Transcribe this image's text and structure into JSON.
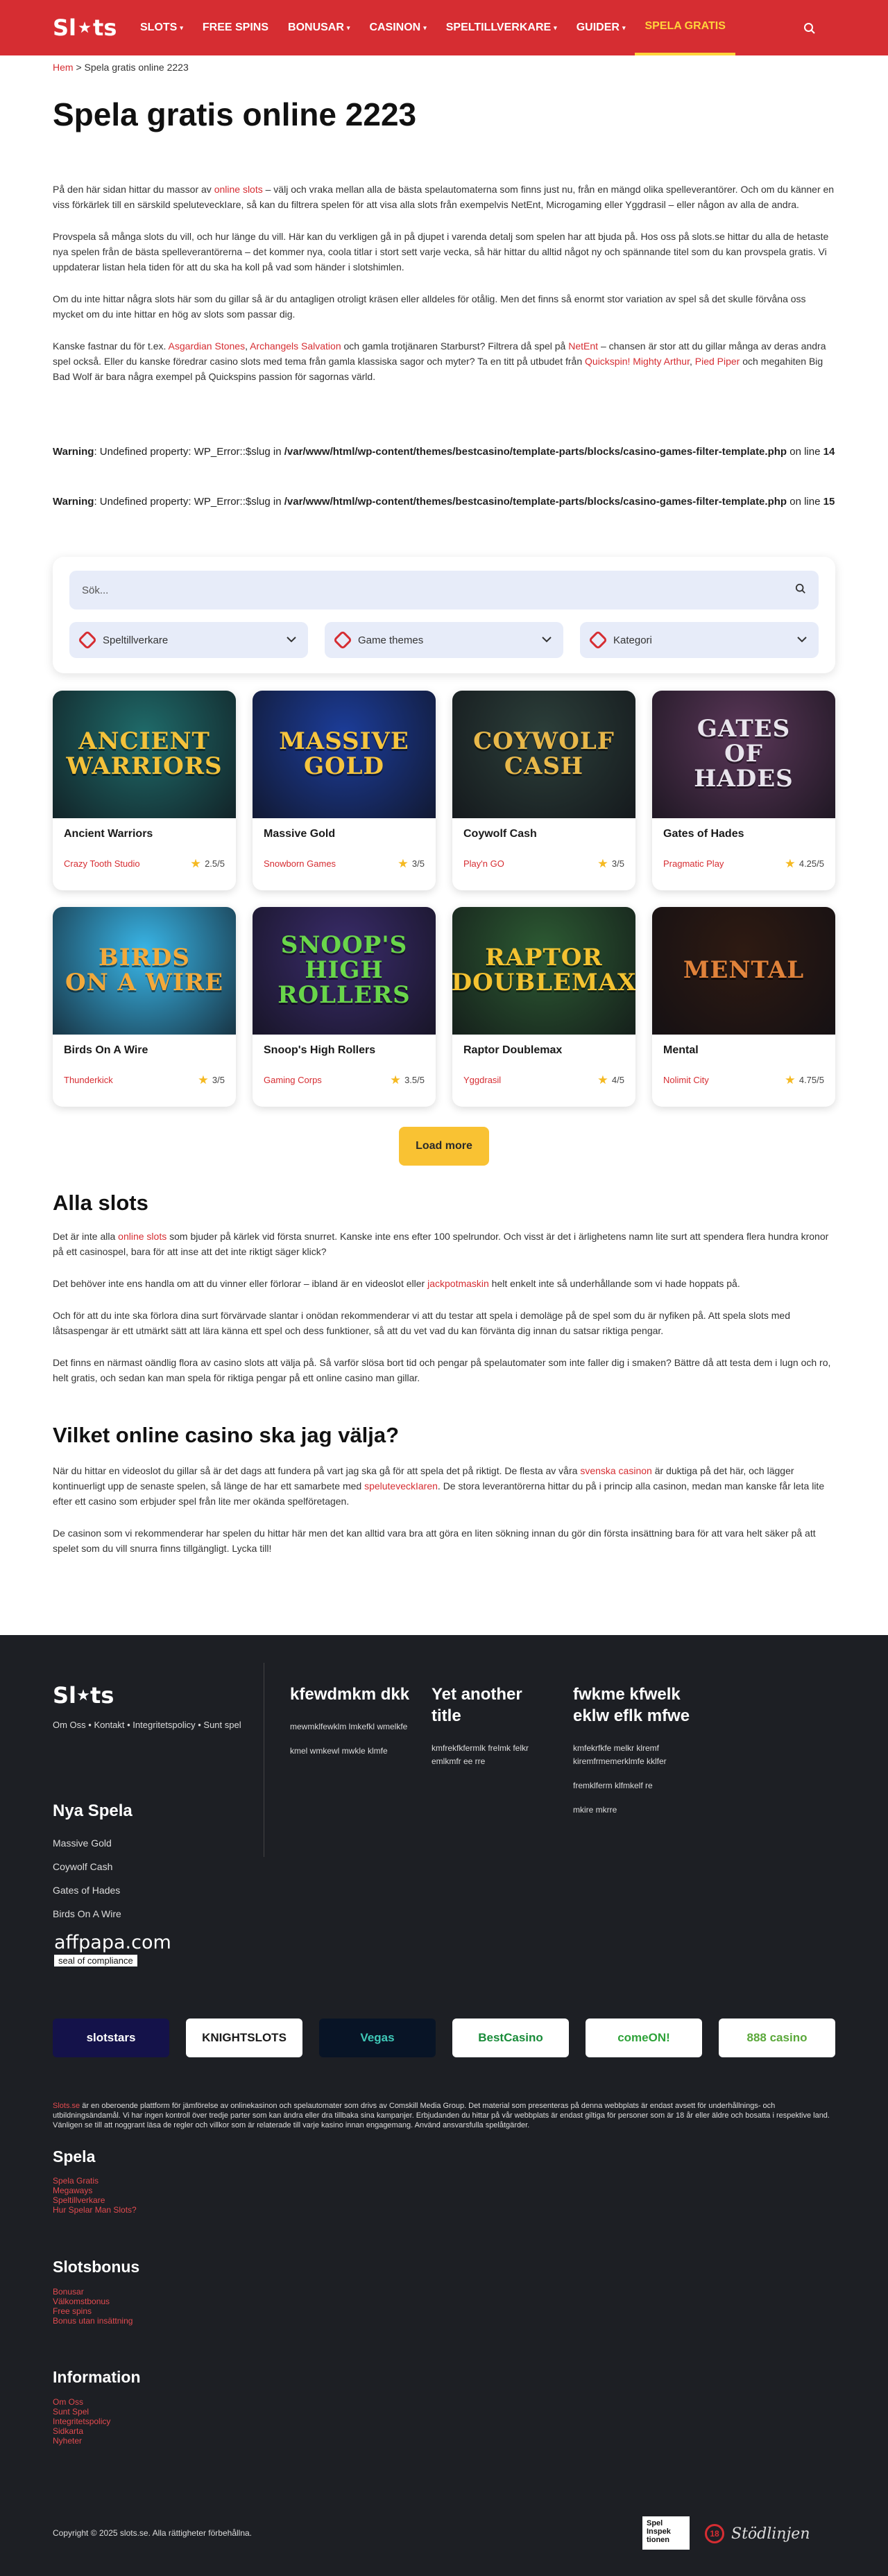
{
  "brand": {
    "logo_left": "Sl",
    "logo_right": "ts"
  },
  "nav": {
    "items": [
      {
        "label": "SLOTS",
        "caret": "▾"
      },
      {
        "label": "FREE SPINS",
        "caret": ""
      },
      {
        "label": "BONUSAR",
        "caret": "▾"
      },
      {
        "label": "CASINON",
        "caret": "▾"
      },
      {
        "label": "SPELTILLVERKARE",
        "caret": "▾"
      },
      {
        "label": "GUIDER",
        "caret": "▾"
      },
      {
        "label": "SPELA GRATIS",
        "caret": ""
      }
    ],
    "search_icon": "search-icon"
  },
  "breadcrumb": {
    "home": "Hem",
    "separator": ">",
    "current": "Spela gratis online 2223"
  },
  "page_title": "Spela gratis online 2223",
  "intro": {
    "p1_a": "På den här sidan hittar du massor av ",
    "p1_link": "online slots",
    "p1_b": " – välj och vraka mellan alla de bästa spelautomaterna som finns just nu, från en mängd olika spelleverantörer. Och om du känner en viss förkärlek till en särskild speluteveckIare, så kan du filtrera spelen för att visa alla slots från exempelvis NetEnt, Microgaming eller Yggdrasil – eller någon av alla de andra.",
    "p2": "Provspela så många slots du vill, och hur länge du vill. Här kan du verkligen gå in på djupet i varenda detalj som spelen har att bjuda på. Hos oss på slots.se hittar du alla de hetaste nya spelen från de bästa spelleverantörerna – det kommer nya, coola titlar i stort sett varje vecka, så här hittar du alltid något ny och spännande titel som du kan provspela gratis. Vi uppdaterar listan hela tiden för att du ska ha koll på vad som händer i slotshimlen.",
    "p3": "Om du inte hittar några slots här som du gillar så är du antagligen otroligt kräsen eller alldeles för otålig. Men det finns så enormt stor variation av spel så det skulle förvåna oss mycket om du inte hittar en hög av slots som passar dig.",
    "p4_a": "Kanske fastnar du för t.ex. ",
    "p4_l1": "Asgardian Stones",
    "p4_c1": ", ",
    "p4_l2": "Archangels Salvation",
    "p4_b": " och gamla trotjänaren Starburst? Filtrera då spel på ",
    "p4_l3": "NetEnt",
    "p4_c": " – chansen är stor att du gillar många av deras andra spel också. Eller du kanske föredrar casino slots med tema från gamla klassiska sagor och myter? Ta en titt på utbudet från ",
    "p4_l4": "Quickspin!",
    "p4_d": " ",
    "p4_l5": "Mighty Arthur",
    "p4_c2": ", ",
    "p4_l6": "Pied Piper",
    "p4_e": " och megahiten Big Bad Wolf är bara några exempel på Quickspins passion för sagornas värld."
  },
  "warnings": [
    {
      "label": "Warning",
      "text": ": Undefined property: WP_Error::$slug in ",
      "path": "/var/www/html/wp-content/themes/bestcasino/template-parts/blocks/casino-games-filter-template.php",
      "on_line": " on line ",
      "line": "14"
    },
    {
      "label": "Warning",
      "text": ": Undefined property: WP_Error::$slug in ",
      "path": "/var/www/html/wp-content/themes/bestcasino/template-parts/blocks/casino-games-filter-template.php",
      "on_line": " on line ",
      "line": "15"
    }
  ],
  "filter": {
    "search_placeholder": "Sök...",
    "selects": [
      {
        "label": "Speltillverkare",
        "icon": "gear-icon"
      },
      {
        "label": "Game themes",
        "icon": "gear-icon"
      },
      {
        "label": "Kategori",
        "icon": "gear-icon"
      }
    ]
  },
  "games": [
    {
      "name": "Ancient Warriors",
      "provider": "Crazy Tooth Studio",
      "rating": "2.5/5",
      "art": "ANCIENT\nWARRIORS",
      "bg": "#1f6b6a",
      "fg": "#f4c23a"
    },
    {
      "name": "Massive Gold",
      "provider": "Snowborn Games",
      "rating": "3/5",
      "art": "MASSIVE\nGOLD",
      "bg": "#1c3d9a",
      "fg": "#f6c53e"
    },
    {
      "name": "Coywolf Cash",
      "provider": "Play'n GO",
      "rating": "3/5",
      "art": "COYWOLF\nCASH",
      "bg": "#2c3f3a",
      "fg": "#e8b84a"
    },
    {
      "name": "Gates of Hades",
      "provider": "Pragmatic Play",
      "rating": "4.25/5",
      "art": "GATES\nOF\nHADES",
      "bg": "#5a3758",
      "fg": "#e8e4ec"
    },
    {
      "name": "Birds On A Wire",
      "provider": "Thunderkick",
      "rating": "3/5",
      "art": "BIRDS\nON A WIRE",
      "bg": "#39b6e8",
      "fg": "#f2a93b"
    },
    {
      "name": "Snoop's High Rollers",
      "provider": "Gaming Corps",
      "rating": "3.5/5",
      "art": "SNOOP'S\nHIGH ROLLERS",
      "bg": "#3a2c6b",
      "fg": "#69d64a"
    },
    {
      "name": "Raptor Doublemax",
      "provider": "Yggdrasil",
      "rating": "4/5",
      "art": "RAPTOR\nDOUBLEMAX",
      "bg": "#2d5b33",
      "fg": "#f4c231"
    },
    {
      "name": "Mental",
      "provider": "Nolimit City",
      "rating": "4.75/5",
      "art": "MENTAL",
      "bg": "#2e1a12",
      "fg": "#e0823a"
    }
  ],
  "load_more": "Load more",
  "alla_slots": {
    "title": "Alla slots",
    "p1_a": "Det är inte alla ",
    "p1_link": "online slots",
    "p1_b": " som bjuder på kärlek vid första snurret. Kanske inte ens efter 100 spelrundor. Och visst är det i ärlighetens namn lite surt att spendera flera hundra kronor på ett casinospel, bara för att inse att det inte riktigt säger klick?",
    "p2_a": "Det behöver inte ens handla om att du vinner eller förlorar – ibland är en videoslot eller ",
    "p2_link": "jackpotmaskin",
    "p2_b": " helt enkelt inte så underhållande som vi hade hoppats på.",
    "p3": "Och för att du inte ska förlora dina surt förvärvade slantar i onödan rekommenderar vi att du testar att spela i demoläge på de spel som du är nyfiken på. Att spela slots med låtsaspengar är ett utmärkt sätt att lära känna ett spel och dess funktioner, så att du vet vad du kan förvänta dig innan du satsar riktiga pengar.",
    "p4": "Det finns en närmast oändlig flora av casino slots att välja på. Så varför slösa bort tid och pengar på spelautomater som inte faller dig i smaken? Bättre då att testa dem i lugn och ro, helt gratis, och sedan kan man spela för riktiga pengar på ett online casino man gillar."
  },
  "vilket": {
    "title": "Vilket online casino ska jag välja?",
    "p1_a": "När du hittar en videoslot du gillar så är det dags att fundera på vart jag ska gå för att spela det på riktigt. De flesta av våra ",
    "p1_l1": "svenska casinon",
    "p1_b": " är duktiga på det här, och lägger kontinuerligt upp de senaste spelen, så länge de har ett samarbete med ",
    "p1_l2": "speluteveckIaren",
    "p1_c": ". De stora leverantörerna hittar du på i princip alla casinon, medan man kanske får leta lite efter ett casino som erbjuder spel från lite mer okända spelföretagen.",
    "p2": "De casinon som vi rekommenderar har spelen du hittar här men det kan alltid vara bra att göra en liten sökning innan du gör din första insättning bara för att vara helt säker på att spelet som du vill snurra finns tillgängligt. Lycka till!"
  },
  "footer": {
    "links": "Om Oss • Kontakt • Integritetspolicy • Sunt spel",
    "cols": [
      {
        "title": "kfewdmkm dkk",
        "items": [
          "mewmklfewklm lmkefkl wmelkfe",
          "kmel wmkewl mwkle klmfe"
        ]
      },
      {
        "title": "Yet another title",
        "items": [
          "kmfrekfkfermlk frelmk felkr emlkmfr ee rre"
        ]
      },
      {
        "title": "fwkme kfwelk eklw eflk mfwe",
        "items": [
          "kmfekrfkfe melkr klremf kiremfrmemerklmfe kklfer",
          "fremklferm klfmkelf re",
          "mkire mkrre"
        ]
      }
    ],
    "nya_title": "Nya Spela",
    "nya_items": [
      "Massive Gold",
      "Coywolf Cash",
      "Gates of Hades",
      "Birds On A Wire"
    ],
    "affpapa": {
      "big": "affpapa.com",
      "small": "seal of compliance"
    },
    "partners": [
      {
        "label": "slotstars",
        "bg": "#14124a",
        "fg": "#ffffff"
      },
      {
        "label": "KNIGHTSLOTS",
        "bg": "#ffffff",
        "fg": "#1a1a1a"
      },
      {
        "label": "Vegas",
        "bg": "#081426",
        "fg": "#3fc8b7"
      },
      {
        "label": "BestCasino",
        "bg": "#ffffff",
        "fg": "#1a8c3a"
      },
      {
        "label": "comeON!",
        "bg": "#ffffff",
        "fg": "#2fa33a"
      },
      {
        "label": "888 casino",
        "bg": "#ffffff",
        "fg": "#5aa83a"
      }
    ],
    "about_a": "Slots.se",
    "about_b": " är en oberoende plattform för jämförelse av onlinekasinon och spelautomater som drivs av Comskill Media Group. Det material som presenteras på denna webbplats är endast avsett för underhållnings- och utbildningsändamål. Vi har ingen kontroll över tredje parter som kan ändra eller dra tillbaka sina kampanjer. Erbjudanden du hittar på vår webbplats är endast giltiga för personer som är 18 år eller äldre och bosatta i respektive land. Vänligen se till att noggrant läsa de regler och villkor som är relaterade till varje kasino innan engagemang. Använd ansvarsfulla spelåtgärder.",
    "spela_title": "Spela",
    "spela_items": [
      "Spela Gratis",
      "Megaways",
      "Speltillverkare",
      "Hur Spelar Man Slots?"
    ],
    "bonus_title": "Slotsbonus",
    "bonus_items": [
      "Bonusar",
      "Välkomstbonus",
      "Free spins",
      "Bonus utan insättning"
    ],
    "info_title": "Information",
    "info_items": [
      "Om Oss",
      "Sunt Spel",
      "Integritetspolicy",
      "Sidkarta",
      "Nyheter"
    ],
    "copyright": "Copyright © 2025 slots.se. Alla rättigheter förbehållna.",
    "spel_badge": [
      "Spel",
      "Inspek",
      "tionen"
    ],
    "stod_ring": "18",
    "stod_text": "Stödlinjen"
  },
  "colors": {
    "brand_red": "#d62d32",
    "accent_yellow": "#f9c233",
    "footer_bg": "#1d1f24"
  }
}
